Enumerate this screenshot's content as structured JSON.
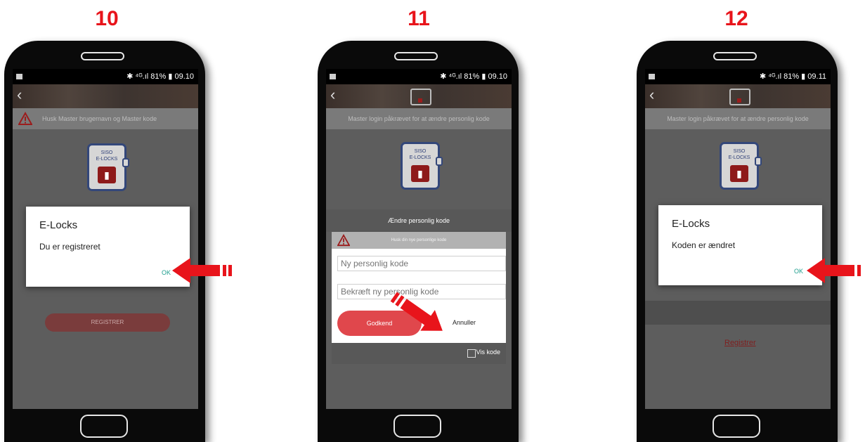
{
  "steps": [
    {
      "number": "10",
      "status_bar": "✱ ⁴ᴳ.ıl 81% ▮ 09.10",
      "info_text": "Husk Master brugernavn og Master kode",
      "logo": {
        "line1": "SISO",
        "line2": "E-LOCKS"
      },
      "background_button": "REGISTRER",
      "dialog": {
        "title": "E-Locks",
        "message": "Du er registreret",
        "ok": "OK"
      }
    },
    {
      "number": "11",
      "status_bar": "✱ ⁴ᴳ.ıl 81% ▮ 09.10",
      "info_text": "Master login påkrævet for at ændre personlig kode",
      "logo": {
        "line1": "SISO",
        "line2": "E-LOCKS"
      },
      "dialog": {
        "title": "Ændre personlig kode",
        "warning": "Husk din nye personlige kode",
        "new_code_placeholder": "Ny personlig kode",
        "confirm_code_placeholder": "Bekræft ny personlig kode",
        "approve": "Godkend",
        "cancel": "Annuller",
        "show_code": "Vis kode"
      }
    },
    {
      "number": "12",
      "status_bar": "✱ ⁴ᴳ.ıl 81% ▮ 09.11",
      "info_text": "Master login påkrævet for at ændre personlig kode",
      "logo": {
        "line1": "SISO",
        "line2": "E-LOCKS"
      },
      "register_link": "Registrer",
      "dialog": {
        "title": "E-Locks",
        "message": "Koden er ændret",
        "ok": "OK"
      }
    }
  ],
  "colors": {
    "step_number": "#e8141b",
    "arrow": "#e8141b",
    "ok_text": "#1f9e8e",
    "approve_button": "#e0474c"
  },
  "icons": [
    "back-arrow-icon",
    "image-notification-icon",
    "warning-triangle-icon",
    "lock-icon",
    "checkbox-icon"
  ]
}
